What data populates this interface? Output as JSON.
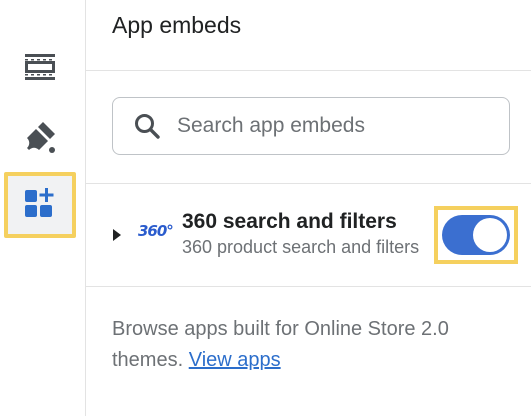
{
  "panel": {
    "title": "App embeds"
  },
  "rail": {
    "items": [
      {
        "icon": "sections-icon",
        "active": false
      },
      {
        "icon": "theme-settings-icon",
        "active": false
      },
      {
        "icon": "app-embeds-icon",
        "active": true
      }
    ]
  },
  "search": {
    "placeholder": "Search app embeds",
    "value": ""
  },
  "embeds": [
    {
      "logo_text": "360°",
      "name": "360 search and filters",
      "description": "360 product search and filters",
      "enabled": true
    }
  ],
  "footer": {
    "text": "Browse apps built for Online Store 2.0 themes.",
    "link_label": "View apps"
  },
  "colors": {
    "accent": "#3b6fd0",
    "link": "#2c6ecb",
    "highlight": "#f5d05e",
    "icon": "#4a4f54"
  }
}
